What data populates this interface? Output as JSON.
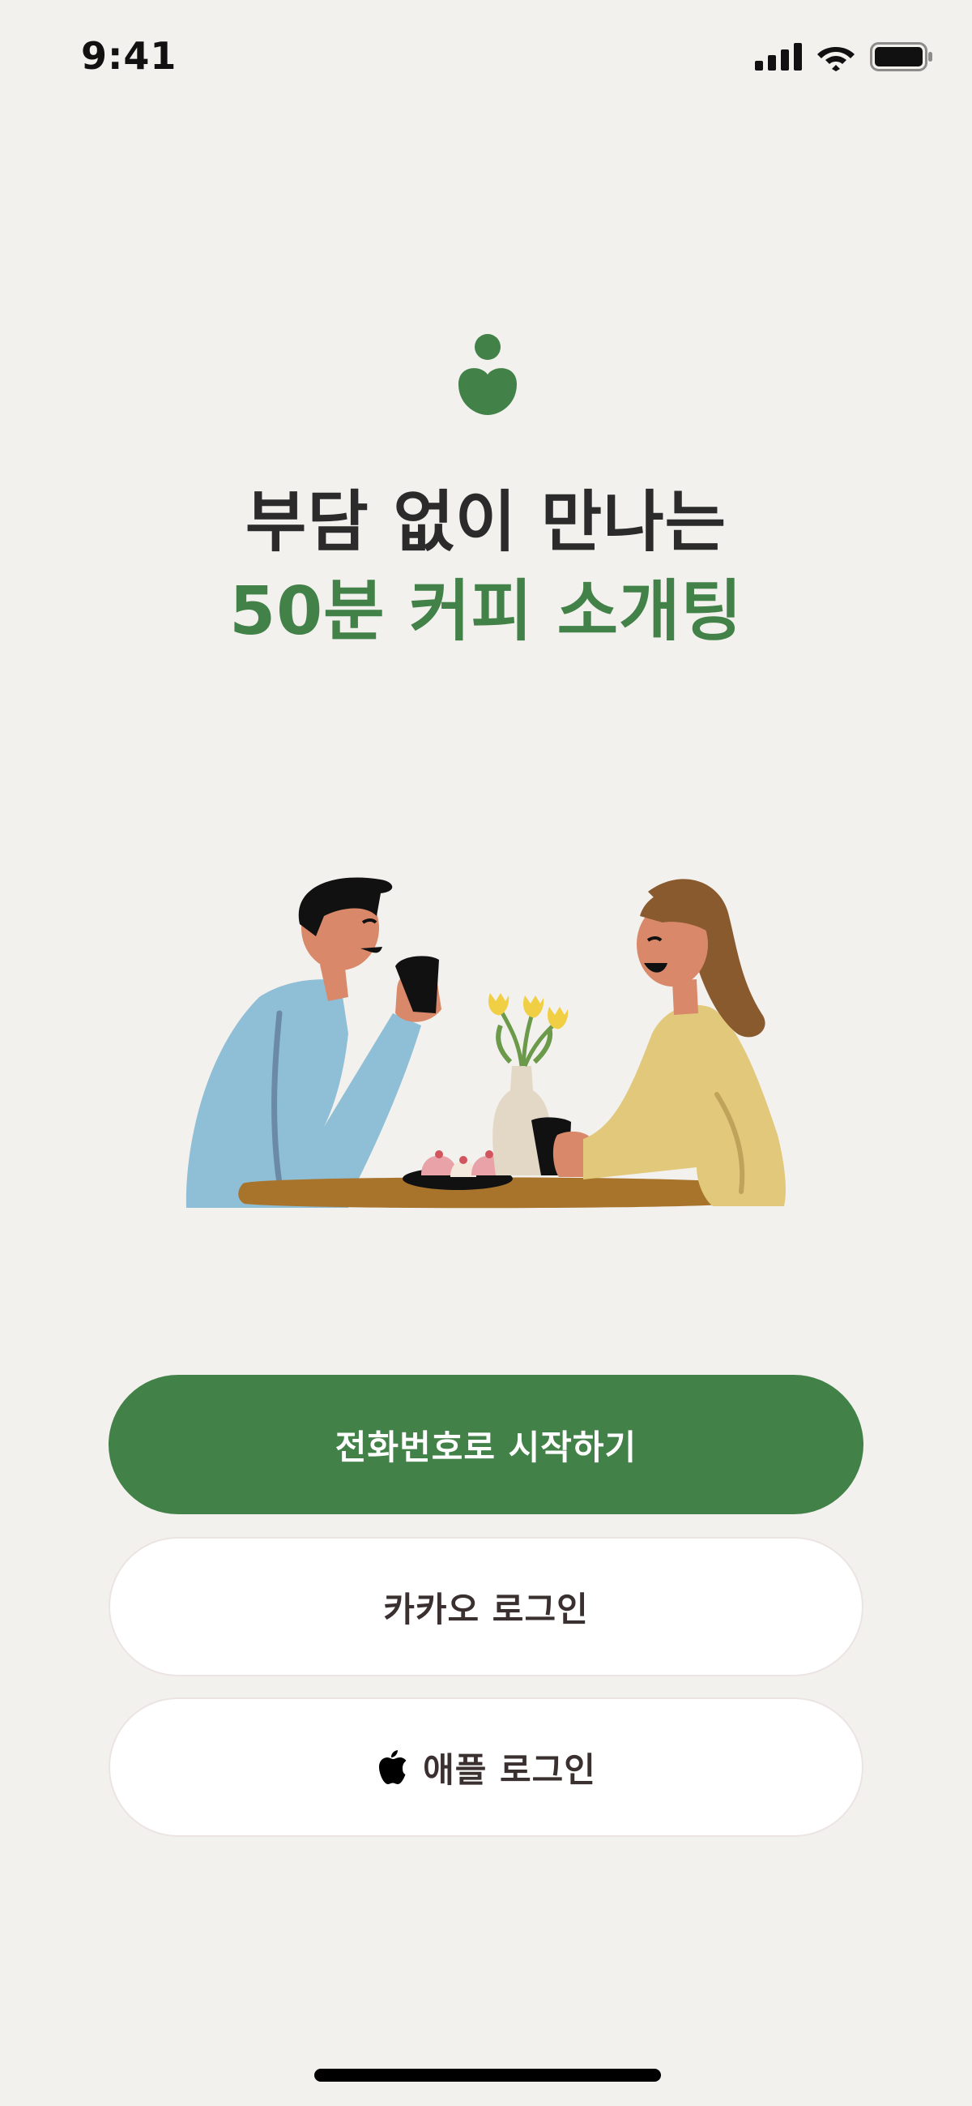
{
  "status_bar": {
    "time": "9:41",
    "icons": [
      "cellular-signal-icon",
      "wifi-icon",
      "battery-icon"
    ]
  },
  "brand": {
    "logo_icon": "person-heart-logo-icon",
    "accent_color": "#428147"
  },
  "headline": {
    "line1": "부담 없이 만나는",
    "line2": "50분 커피 소개팅"
  },
  "illustration": {
    "icon": "couple-coffee-date-illustration"
  },
  "buttons": {
    "phone_start": "전화번호로 시작하기",
    "kakao_login": "카카오 로그인",
    "apple_login": "애플 로그인",
    "apple_icon": "apple-logo-icon"
  }
}
